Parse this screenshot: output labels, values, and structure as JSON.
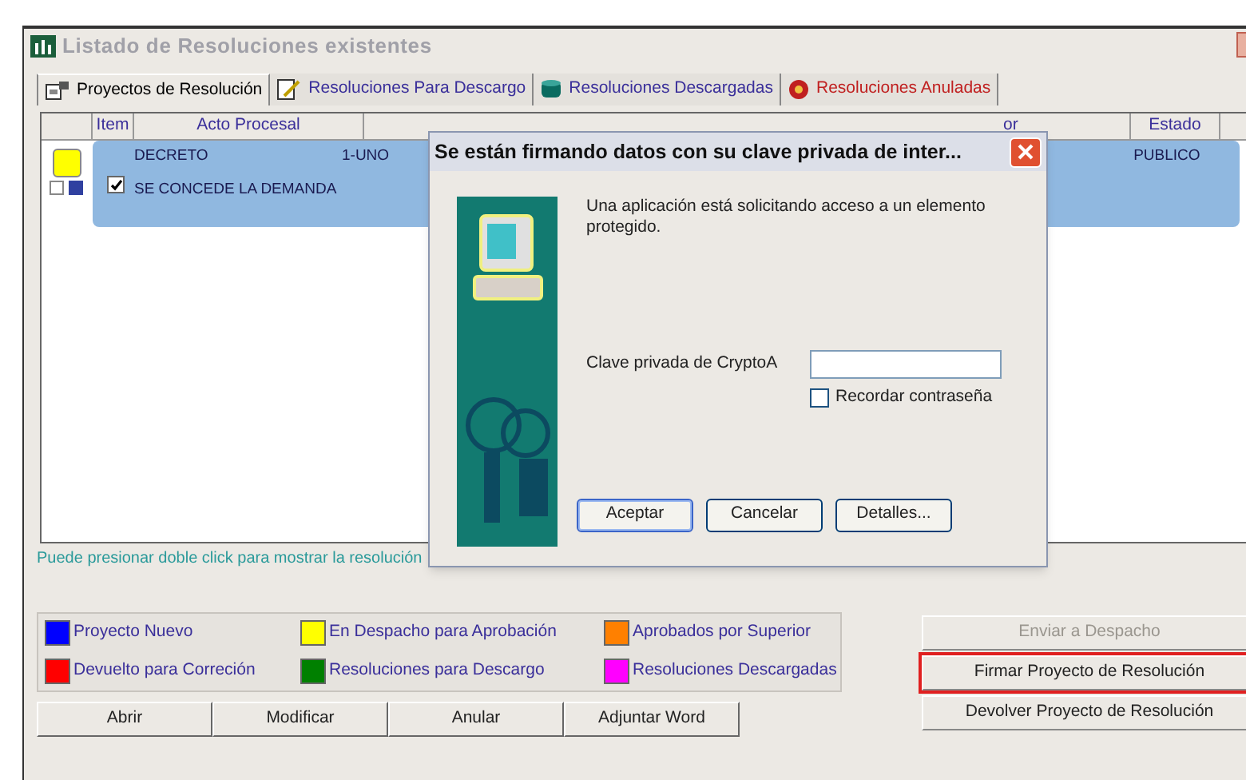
{
  "window": {
    "title": "Listado de Resoluciones existentes"
  },
  "tabs": [
    {
      "label": "Proyectos de Resolución",
      "selected": true,
      "kind": "projects"
    },
    {
      "label": "Resoluciones Para Descargo",
      "selected": false,
      "kind": "edit"
    },
    {
      "label": "Resoluciones Descargadas",
      "selected": false,
      "kind": "database"
    },
    {
      "label": "Resoluciones Anuladas",
      "selected": false,
      "kind": "cancelled"
    }
  ],
  "table": {
    "columns": [
      "Item",
      "Acto Procesal",
      "or",
      "Estado"
    ],
    "rows": [
      {
        "color": "#ffff00",
        "checked": true,
        "selected": true,
        "acto": "DECRETO",
        "detalle": "SE CONCEDE LA DEMANDA",
        "column_3": "1-UNO",
        "estado": "PUBLICO"
      }
    ]
  },
  "hint": "Puede presionar doble click para mostrar la resolución",
  "legend": [
    {
      "label": "Proyecto Nuevo",
      "color": "#0000ff"
    },
    {
      "label": "En Despacho para Aprobación",
      "color": "#ffff00"
    },
    {
      "label": "Aprobados por Superior",
      "color": "#ff8000"
    },
    {
      "label": "Devuelto para Correción",
      "color": "#ff0000"
    },
    {
      "label": "Resoluciones para Descargo",
      "color": "#008000"
    },
    {
      "label": "Resoluciones Descargadas",
      "color": "#ff00ff"
    }
  ],
  "side_buttons": [
    {
      "label": "Enviar a Despacho",
      "disabled": true,
      "highlighted": false
    },
    {
      "label": "Firmar Proyecto de Resolución",
      "disabled": false,
      "highlighted": true
    },
    {
      "label": "Devolver Proyecto de Resolución",
      "disabled": false,
      "highlighted": false
    }
  ],
  "bottom_buttons": [
    "Abrir",
    "Modificar",
    "Anular",
    "Adjuntar Word"
  ],
  "dialog": {
    "title": "Se están firmando datos con su clave privada de inter...",
    "message": "Una aplicación está solicitando acceso a un elemento protegido.",
    "field_label": "Clave privada de CryptoA",
    "remember": {
      "label": "Recordar contraseña",
      "checked": false
    },
    "buttons": [
      {
        "label": "Aceptar",
        "default": true
      },
      {
        "label": "Cancelar",
        "default": false
      },
      {
        "label": "Detalles...",
        "default": false
      }
    ]
  }
}
